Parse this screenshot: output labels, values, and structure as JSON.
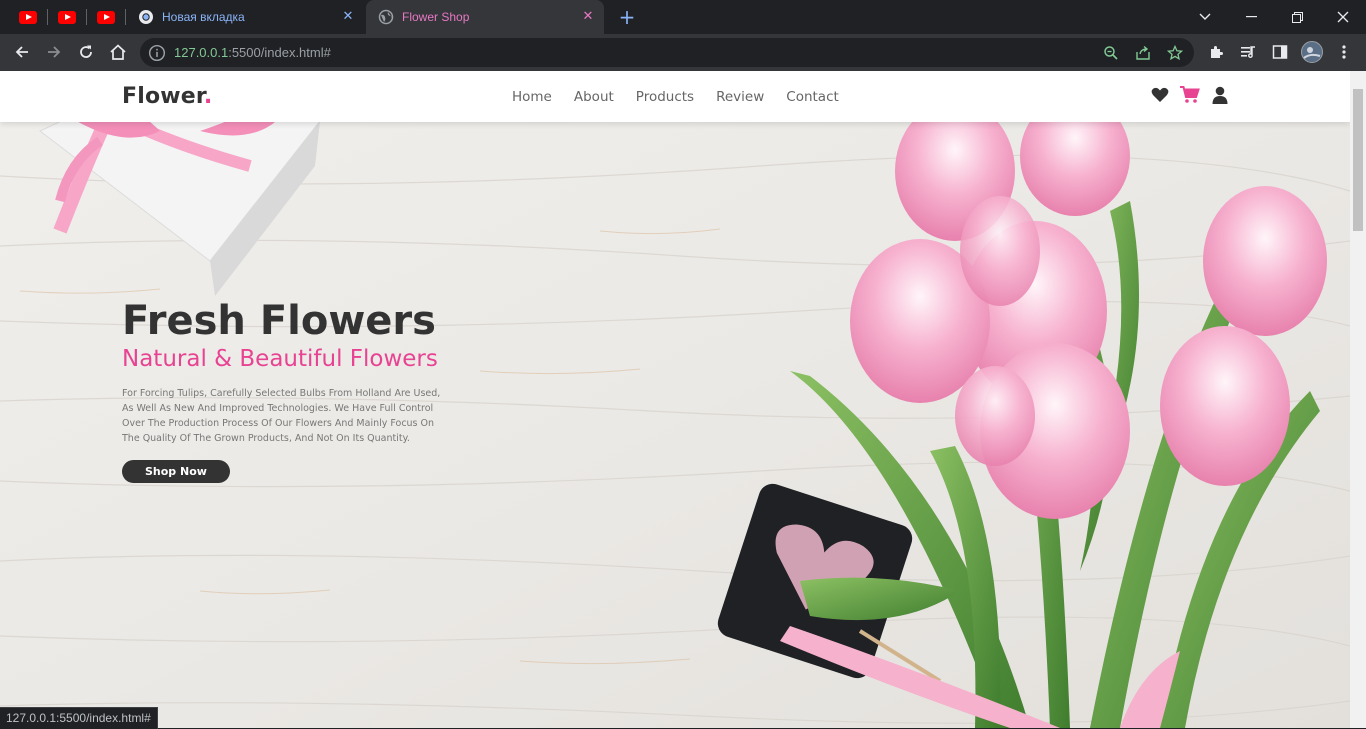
{
  "browser": {
    "tabs": [
      {
        "label": "Новая вкладка",
        "active": false
      },
      {
        "label": "Flower Shop",
        "active": true
      }
    ],
    "url_host": "127.0.0.1",
    "url_rest": ":5500/index.html#",
    "status_url": "127.0.0.1:5500/index.html#"
  },
  "site": {
    "logo_text": "Flower",
    "logo_dot": ".",
    "nav": [
      "Home",
      "About",
      "Products",
      "Review",
      "Contact"
    ],
    "icons": [
      "heart-icon",
      "cart-icon",
      "user-icon"
    ],
    "accent_color": "#e84393"
  },
  "hero": {
    "title": "Fresh Flowers",
    "subtitle": "Natural & Beautiful Flowers",
    "text": "For Forcing Tulips, Carefully Selected Bulbs From Holland Are Used, As Well As New And Improved Technologies. We Have Full Control Over The Production Process Of Our Flowers And Mainly Focus On The Quality Of The Grown Products, And Not On Its Quantity.",
    "button": "Shop Now"
  }
}
